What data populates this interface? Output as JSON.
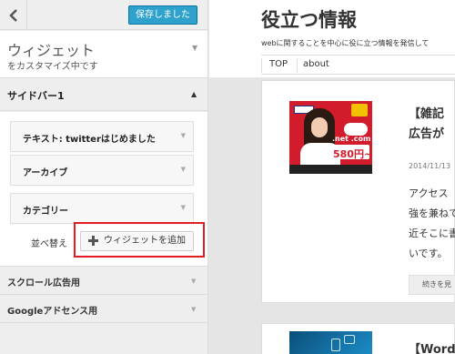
{
  "customizer": {
    "save_label": "保存しました",
    "panel_title": "ウィジェット",
    "panel_subtitle": "をカスタマイズ中です",
    "sidebar_section": "サイドバー1",
    "widgets": [
      {
        "label": "テキスト: twitterはじめました"
      },
      {
        "label": "アーカイブ"
      },
      {
        "label": "カテゴリー"
      }
    ],
    "reorder_label": "並べ替え",
    "add_widget_label": "ウィジェットを追加",
    "other_sections": [
      {
        "label": "スクロール広告用"
      },
      {
        "label": "Googleアドセンス用"
      }
    ],
    "accent_color": "#2ea2cc",
    "highlight_color": "#e31b23"
  },
  "preview": {
    "site_title": "役立つ情報",
    "site_description": "webに関することを中心に役に立つ情報を発信して",
    "nav": [
      "TOP",
      "about"
    ],
    "post": {
      "thumbnail_text": ".net\n.comドメイン",
      "thumbnail_price": "580円~",
      "title_line1": "【雑記",
      "title_line2": "広告が",
      "date": "2014/11/13",
      "excerpt_line1": "アクセス",
      "excerpt_line2": "強を兼ねて",
      "excerpt_line3": "近そこに書",
      "excerpt_line4": "いです。",
      "more_label": "続きを見"
    },
    "post2": {
      "title": "【Word"
    }
  }
}
